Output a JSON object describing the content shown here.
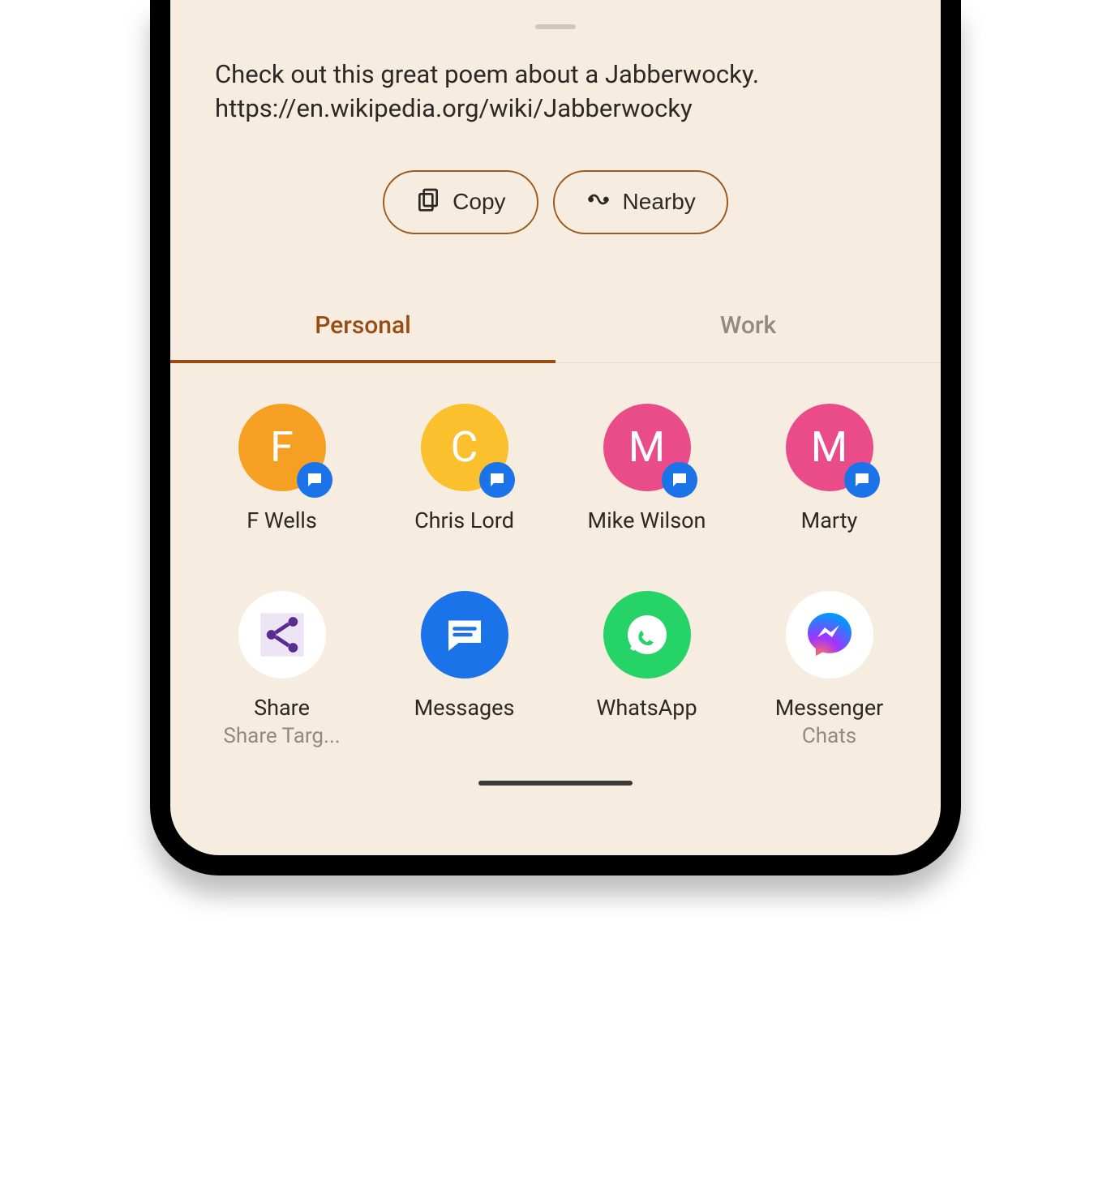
{
  "share": {
    "text_line1": "Check out this great poem about a Jabberwocky.",
    "text_line2": "https://en.wikipedia.org/wiki/Jabberwocky",
    "copy_label": "Copy",
    "nearby_label": "Nearby"
  },
  "tabs": {
    "personal": "Personal",
    "work": "Work"
  },
  "contacts": [
    {
      "initial": "F",
      "name": "F Wells",
      "color": "#f5a023"
    },
    {
      "initial": "C",
      "name": "Chris Lord",
      "color": "#fbc02d"
    },
    {
      "initial": "M",
      "name": "Mike Wilson",
      "color": "#ea4c89"
    },
    {
      "initial": "M",
      "name": "Marty",
      "color": "#ea4c89"
    }
  ],
  "apps": [
    {
      "name": "Share",
      "sub": "Share Targ...",
      "icon": "share"
    },
    {
      "name": "Messages",
      "sub": "",
      "icon": "messages"
    },
    {
      "name": "WhatsApp",
      "sub": "",
      "icon": "whatsapp"
    },
    {
      "name": "Messenger",
      "sub": "Chats",
      "icon": "messenger"
    }
  ]
}
